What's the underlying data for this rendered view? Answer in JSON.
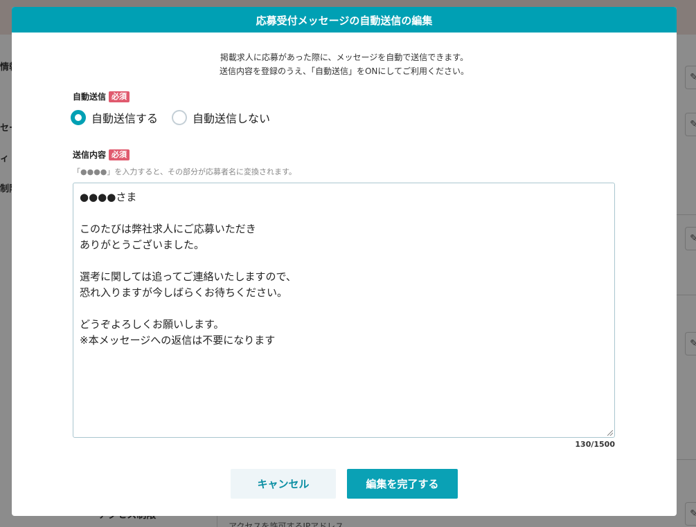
{
  "background": {
    "sidebar_labels": [
      "情報",
      "セー",
      "ィ",
      "制限"
    ],
    "bottom_left_text": "アクセス制限",
    "bottom_right_text": "アクセスを許可するIPアドレス",
    "edit_icon": "pencil-icon"
  },
  "modal": {
    "title": "応募受付メッセージの自動送信の編集",
    "intro_line1": "掲載求人に応募があった際に、メッセージを自動で送信できます。",
    "intro_line2": "送信内容を登録のうえ、「自動送信」をONにしてご利用ください。",
    "auto_send": {
      "label": "自動送信",
      "required": "必須",
      "options": [
        {
          "label": "自動送信する",
          "selected": true
        },
        {
          "label": "自動送信しない",
          "selected": false
        }
      ]
    },
    "content": {
      "label": "送信内容",
      "required": "必須",
      "hint": "「●●●●」を入力すると、その部分が応募者名に変換されます。",
      "message": "●●●●さま\n\nこのたびは弊社求人にご応募いただき\nありがとうございました。\n\n選考に関しては追ってご連絡いたしますので、\n恐れ入りますが今しばらくお待ちください。\n\nどうぞよろしくお願いします。\n※本メッセージへの返信は不要になります",
      "char_count": "130/1500"
    },
    "buttons": {
      "cancel": "キャンセル",
      "complete": "編集を完了する"
    }
  },
  "colors": {
    "accent": "#00a0b4",
    "required": "#e05a6e"
  }
}
